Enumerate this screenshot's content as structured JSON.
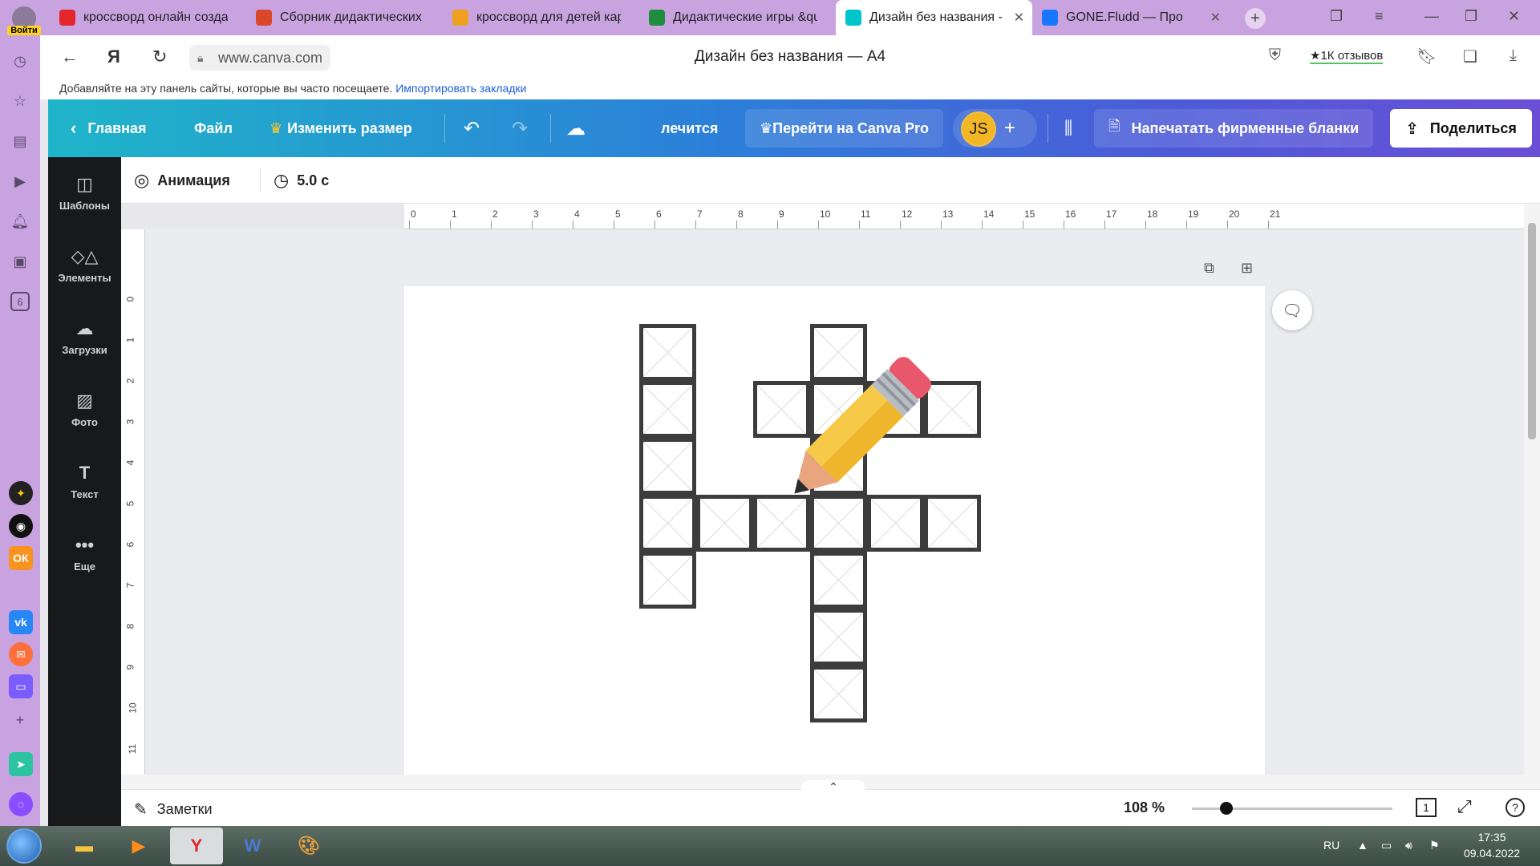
{
  "browser": {
    "login_label": "Войти",
    "tabs": [
      {
        "title": "кроссворд онлайн созда",
        "icon": "yandex-icon",
        "color": "#e3262a",
        "active": false
      },
      {
        "title": "Сборник дидактических",
        "icon": "presentation-icon",
        "color": "#d9482a",
        "active": false
      },
      {
        "title": "кроссворд для детей кар",
        "icon": "image-icon",
        "color": "#f0a020",
        "active": false
      },
      {
        "title": "Дидактические игры &qu",
        "icon": "checkbox-icon",
        "color": "#1e8e3e",
        "active": false
      },
      {
        "title": "Дизайн без названия - ",
        "icon": "canva-icon",
        "color": "#00c4cc",
        "active": true
      },
      {
        "title": "GONE.Fludd — Про",
        "icon": "play-icon",
        "color": "#1976ff",
        "active": false
      }
    ],
    "url": "www.canva.com",
    "page_title": "Дизайн без названия — A4",
    "reviews_label": "★1К отзывов",
    "bookmarks_hint": "Добавляйте на эту панель сайты, которые вы часто посещаете.",
    "bookmarks_link": "Импортировать закладки",
    "sidebar_badge": "6"
  },
  "canva": {
    "home_label": "Главная",
    "file_label": "Файл",
    "resize_label": "Изменить размер",
    "status_label": "лечится",
    "pro_label": "Перейти на Canva Pro",
    "avatar_initials": "JS",
    "print_label": "Напечатать фирменные бланки",
    "share_label": "Поделиться",
    "side_items": [
      "Шаблоны",
      "Элементы",
      "Загрузки",
      "Фото",
      "Текст",
      "Еще"
    ],
    "animation_label": "Анимация",
    "duration_label": "5.0 с",
    "ruler_h": [
      "0",
      "1",
      "2",
      "3",
      "4",
      "5",
      "6",
      "7",
      "8",
      "9",
      "10",
      "11",
      "12",
      "13",
      "14",
      "15",
      "16",
      "17",
      "18",
      "19",
      "20",
      "21"
    ],
    "ruler_v": [
      "0",
      "1",
      "2",
      "3",
      "4",
      "5",
      "6",
      "7",
      "8",
      "9",
      "10",
      "11"
    ],
    "notes_label": "Заметки",
    "zoom_label": "108 %",
    "zoom_fraction": 0.17,
    "page_count": "1",
    "help_label": "?"
  },
  "taskbar": {
    "lang": "RU",
    "time": "17:35",
    "date": "09.04.2022"
  }
}
